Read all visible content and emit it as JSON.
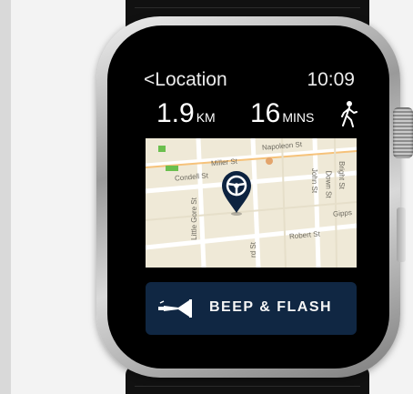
{
  "header": {
    "back_label": "<Location",
    "time": "10:09"
  },
  "stats": {
    "distance_value": "1.9",
    "distance_unit": "KM",
    "duration_value": "16",
    "duration_unit": "MINS"
  },
  "map": {
    "streets": [
      "Napoleon St",
      "Miller St",
      "Condell St",
      "John St",
      "Down St",
      "Bright St",
      "Little Gore St",
      "Gipps",
      "Robert St",
      "rd St"
    ]
  },
  "action": {
    "beep_label": "BEEP & FLASH"
  },
  "icons": {
    "walk": "walking-person-icon",
    "pin": "steering-wheel-pin-icon",
    "horn": "horn-icon"
  },
  "colors": {
    "button_bg": "#102743",
    "pin": "#0d2340",
    "map_bg": "#efe9d7"
  }
}
